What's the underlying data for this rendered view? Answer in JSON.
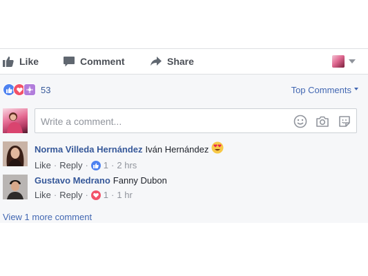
{
  "actions": {
    "like_label": "Like",
    "comment_label": "Comment",
    "share_label": "Share"
  },
  "reactions": {
    "count": "53",
    "types": [
      "like-icon",
      "love-icon",
      "wow-icon"
    ]
  },
  "sort": {
    "label": "Top Comments"
  },
  "composer": {
    "placeholder": "Write a comment...",
    "icons": [
      "emoji-icon",
      "camera-icon",
      "sticker-icon"
    ]
  },
  "comments": [
    {
      "author": "Norma Villeda Hernández",
      "text": "Iván Hernández",
      "emoji": "heart-eyes-emoji",
      "like_label": "Like",
      "reply_label": "Reply",
      "reaction_type": "like",
      "reaction_count": "1",
      "time": "2 hrs"
    },
    {
      "author": "Gustavo Medrano",
      "text": "Fanny Dubon",
      "like_label": "Like",
      "reply_label": "Reply",
      "reaction_type": "love",
      "reaction_count": "1",
      "time": "1 hr"
    }
  ],
  "view_more": "View 1 more comment",
  "colors": {
    "link": "#365899",
    "accent": "#4267b2",
    "panel_bg": "#f6f7f9",
    "like_blue": "#4e82f0",
    "love_red": "#f25268"
  }
}
